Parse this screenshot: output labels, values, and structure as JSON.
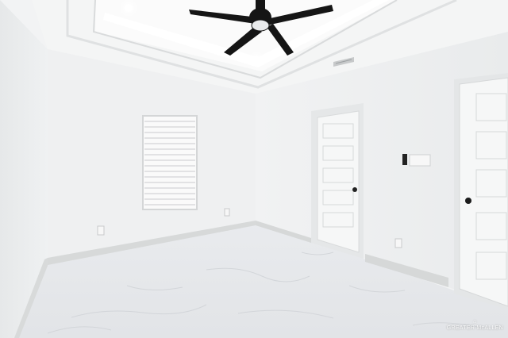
{
  "scene": {
    "watermark_text": "GREATER McALLEN",
    "colors": {
      "wall_left": "#eceeef",
      "wall_back": "#f2f3f4",
      "wall_right": "#eef0f1",
      "ceiling": "#f7f8f8",
      "tray": "#fbfbfb",
      "floor": "#e7e9ec",
      "baseboard": "#d6d8d8",
      "door": "#f6f7f7",
      "fan": "#151515"
    },
    "icons": [
      "ceiling-fan-icon",
      "recessed-light-icon",
      "air-vent-icon",
      "door-knob-icon"
    ]
  }
}
